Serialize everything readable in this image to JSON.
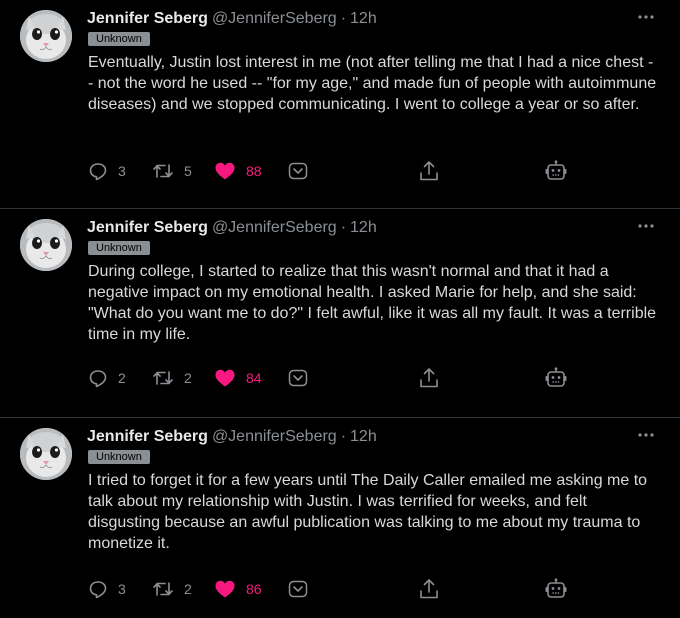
{
  "colors": {
    "background": "#000000",
    "text": "#d9d9d9",
    "secondary": "#8b8f93",
    "like": "#f91880",
    "badge_bg": "#8a8f94"
  },
  "tweets": [
    {
      "name": "Jennifer Seberg",
      "handle": "@JenniferSeberg",
      "separator": "·",
      "time": "12h",
      "badge": "Unknown",
      "text": "Eventually, Justin lost interest in me (not after telling me that I had a nice chest -- not the word he used -- \"for my age,\" and made fun of people with autoimmune diseases) and we stopped communicating. I went to college a year or so after.",
      "replies": "3",
      "retweets": "5",
      "likes": "88"
    },
    {
      "name": "Jennifer Seberg",
      "handle": "@JenniferSeberg",
      "separator": "·",
      "time": "12h",
      "badge": "Unknown",
      "text": "During college, I started to realize that this wasn't normal and that it had a negative impact on my emotional health. I asked Marie for help, and she said: \"What do you want me to do?\" I felt awful, like it was all my fault. It was a terrible time in my life.",
      "replies": "2",
      "retweets": "2",
      "likes": "84"
    },
    {
      "name": "Jennifer Seberg",
      "handle": "@JenniferSeberg",
      "separator": "·",
      "time": "12h",
      "badge": "Unknown",
      "text": "I tried to forget it for a few years until The Daily Caller emailed me asking me to talk about my relationship with Justin. I was terrified for weeks, and felt disgusting because an awful publication was talking to me about my trauma to monetize it.",
      "replies": "3",
      "retweets": "2",
      "likes": "86"
    }
  ],
  "icons": {
    "avatar": "cat-avatar-icon",
    "more": "more-horizontal-icon",
    "reply": "reply-icon",
    "retweet": "retweet-icon",
    "like": "heart-icon",
    "caret": "chevron-down-icon",
    "share": "share-icon",
    "bot": "robot-icon"
  }
}
